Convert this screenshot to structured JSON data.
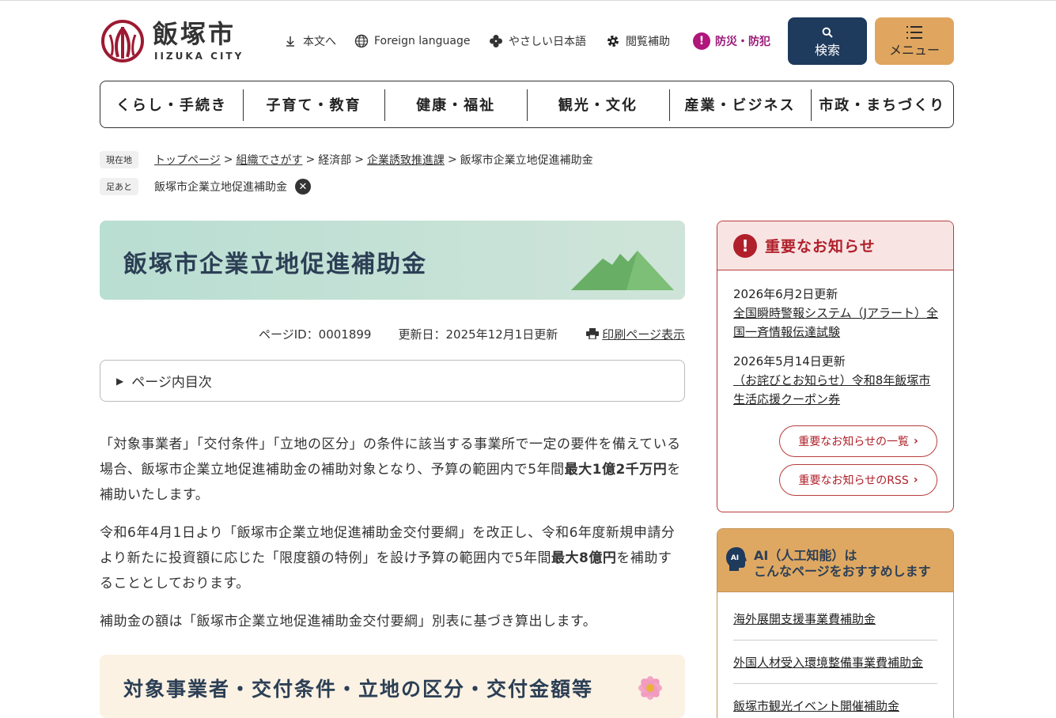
{
  "header": {
    "logo_ja": "飯塚市",
    "logo_en": "IIZUKA CITY",
    "util": {
      "skip": "本文へ",
      "foreign": "Foreign language",
      "easy_japanese": "やさしい日本語",
      "accessibility": "閲覧補助",
      "disaster": "防災・防犯"
    },
    "search_label": "検索",
    "menu_label": "メニュー"
  },
  "gnav": [
    "くらし・手続き",
    "子育て・教育",
    "健康・福祉",
    "観光・文化",
    "産業・ビジネス",
    "市政・まちづくり"
  ],
  "breadcrumb": {
    "current_tag": "現在地",
    "items": [
      "トップページ",
      "組織でさがす",
      "経済部",
      "企業誘致推進課",
      "飯塚市企業立地促進補助金"
    ],
    "sep": ">",
    "history_tag": "足あと",
    "history_item": "飯塚市企業立地促進補助金"
  },
  "main": {
    "title": "飯塚市企業立地促進補助金",
    "page_id": "ページID：0001899",
    "updated": "更新日：2025年12月1日更新",
    "print": "印刷ページ表示",
    "toc": "ページ内目次",
    "p1_before": "「対象事業者」「交付条件」「立地の区分」の条件に該当する事業所で一定の要件を備えている場合、飯塚市企業立地促進補助金の補助対象となり、予算の範囲内で5年間",
    "p1_bold": "最大1億2千万円",
    "p1_after": "を補助いたします。",
    "p2_before": "令和6年4月1日より「飯塚市企業立地促進補助金交付要綱」を改正し、令和6年度新規申請分より新たに投資額に応じた「限度額の特例」を設け予算の範囲内で5年間",
    "p2_bold": "最大8億円",
    "p2_after": "を補助することとしております。",
    "p3": "補助金の額は「飯塚市企業立地促進補助金交付要綱」別表に基づき算出します。",
    "section_title": "対象事業者・交付条件・立地の区分・交付金額等"
  },
  "notice": {
    "title": "重要なお知らせ",
    "items": [
      {
        "date": "2026年6月2日更新",
        "text": "全国瞬時警報システム（Jアラート）全国一斉情報伝達試験"
      },
      {
        "date": "2026年5月14日更新",
        "text": "（お詫びとお知らせ）令和8年飯塚市生活応援クーポン券"
      }
    ],
    "list_link": "重要なお知らせの一覧",
    "rss_link": "重要なお知らせのRSS"
  },
  "ai": {
    "badge": "AI",
    "title1": "AI（人工知能）は",
    "title2": "こんなページをおすすめします",
    "links": [
      "海外展開支援事業費補助金",
      "外国人材受入環境整備事業費補助金",
      "飯塚市観光イベント開催補助金"
    ]
  },
  "colors": {
    "navy": "#1e3a5c",
    "orange": "#e0a65f",
    "alert_red": "#b0202a",
    "disaster_purple": "#b0167b",
    "title_green": "#b9ded2",
    "section_cream": "#fbf2e4"
  }
}
